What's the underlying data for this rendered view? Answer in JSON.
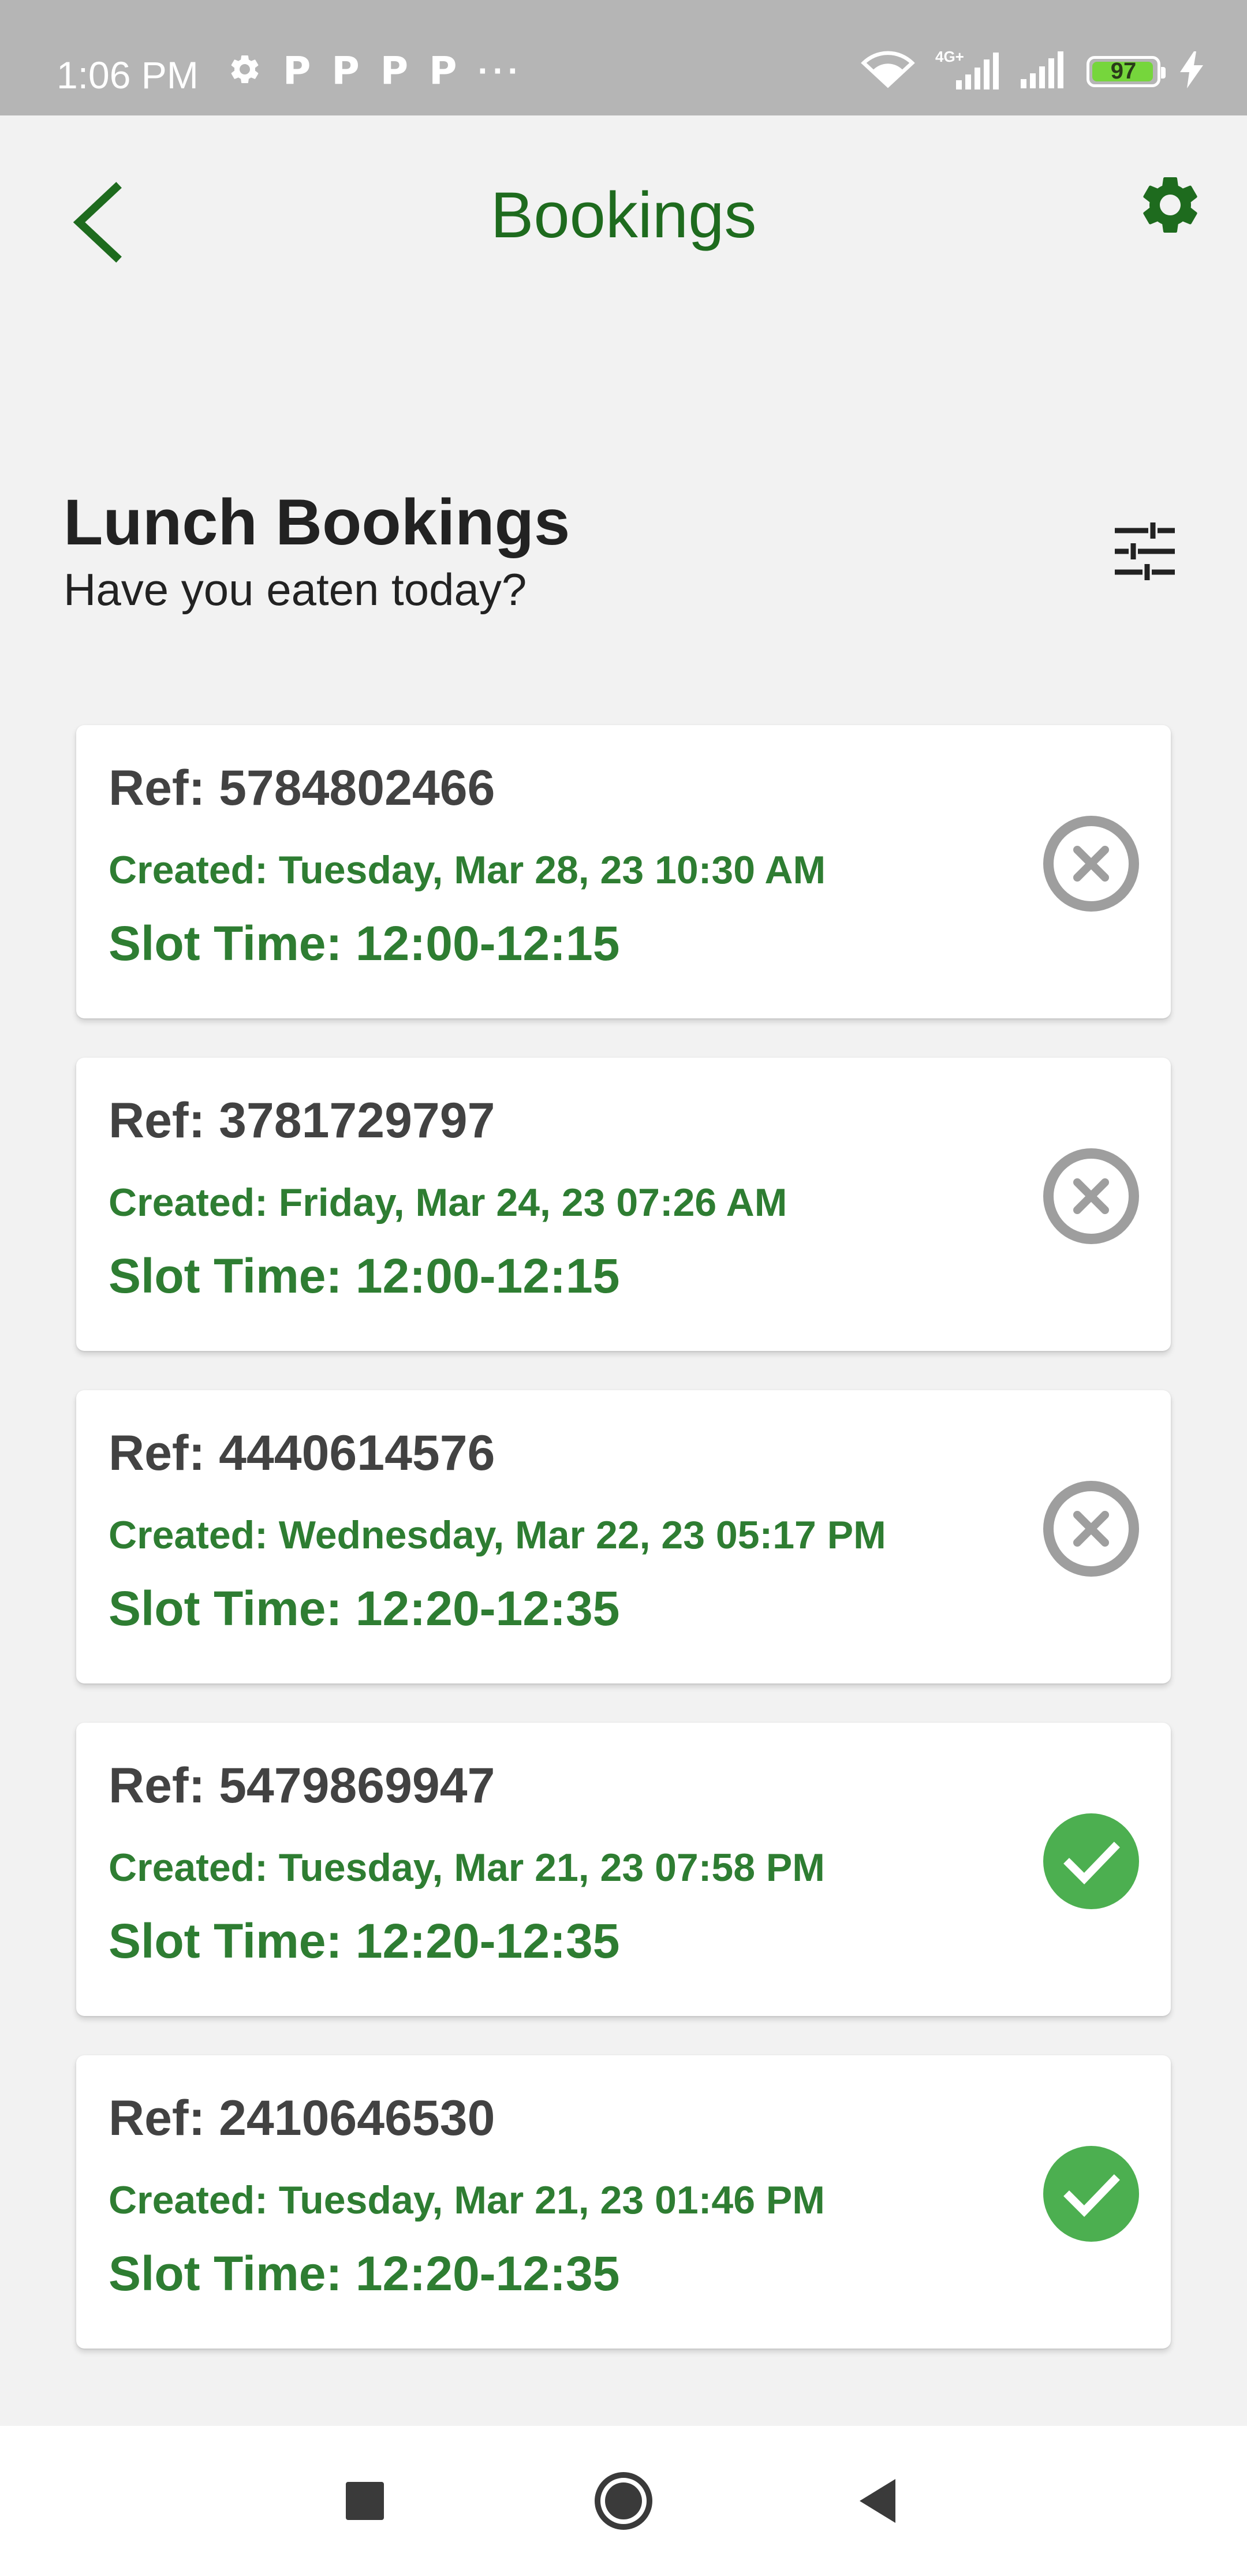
{
  "status_bar": {
    "time": "1:06 PM",
    "notification_icons": [
      "gear-icon",
      "p-icon",
      "p-icon",
      "p-icon",
      "p-icon",
      "more-dots-icon"
    ],
    "p_glyph": "P",
    "dots": "···",
    "network_label": "4G+",
    "battery_level": "97",
    "battery_color": "#76d63c"
  },
  "app_bar": {
    "title": "Bookings",
    "back_icon": "chevron-left-icon",
    "settings_icon": "gear-icon",
    "accent_color": "#1e6b1e"
  },
  "section": {
    "title": "Lunch Bookings",
    "subtitle": "Have you eaten today?",
    "filter_icon": "tune-sliders-icon"
  },
  "bookings": [
    {
      "ref": "Ref: 5784802466",
      "created": "Created: Tuesday, Mar 28, 23 10:30 AM",
      "slot": "Slot Time: 12:00-12:15",
      "status": "cancelled"
    },
    {
      "ref": "Ref: 3781729797",
      "created": "Created: Friday, Mar 24, 23 07:26 AM",
      "slot": "Slot Time: 12:00-12:15",
      "status": "cancelled"
    },
    {
      "ref": "Ref: 4440614576",
      "created": "Created: Wednesday, Mar 22, 23 05:17 PM",
      "slot": "Slot Time: 12:20-12:35",
      "status": "cancelled"
    },
    {
      "ref": "Ref: 5479869947",
      "created": "Created: Tuesday, Mar 21, 23 07:58 PM",
      "slot": "Slot Time: 12:20-12:35",
      "status": "completed"
    },
    {
      "ref": "Ref: 2410646530",
      "created": "Created: Tuesday, Mar 21, 23 01:46 PM",
      "slot": "Slot Time: 12:20-12:35",
      "status": "completed"
    }
  ],
  "status_colors": {
    "cancelled": "#9e9e9e",
    "completed": "#4caf50",
    "text_green": "#2e7d32"
  },
  "nav_bar": {
    "items": [
      "recents-square-icon",
      "home-circle-icon",
      "back-triangle-icon"
    ]
  }
}
